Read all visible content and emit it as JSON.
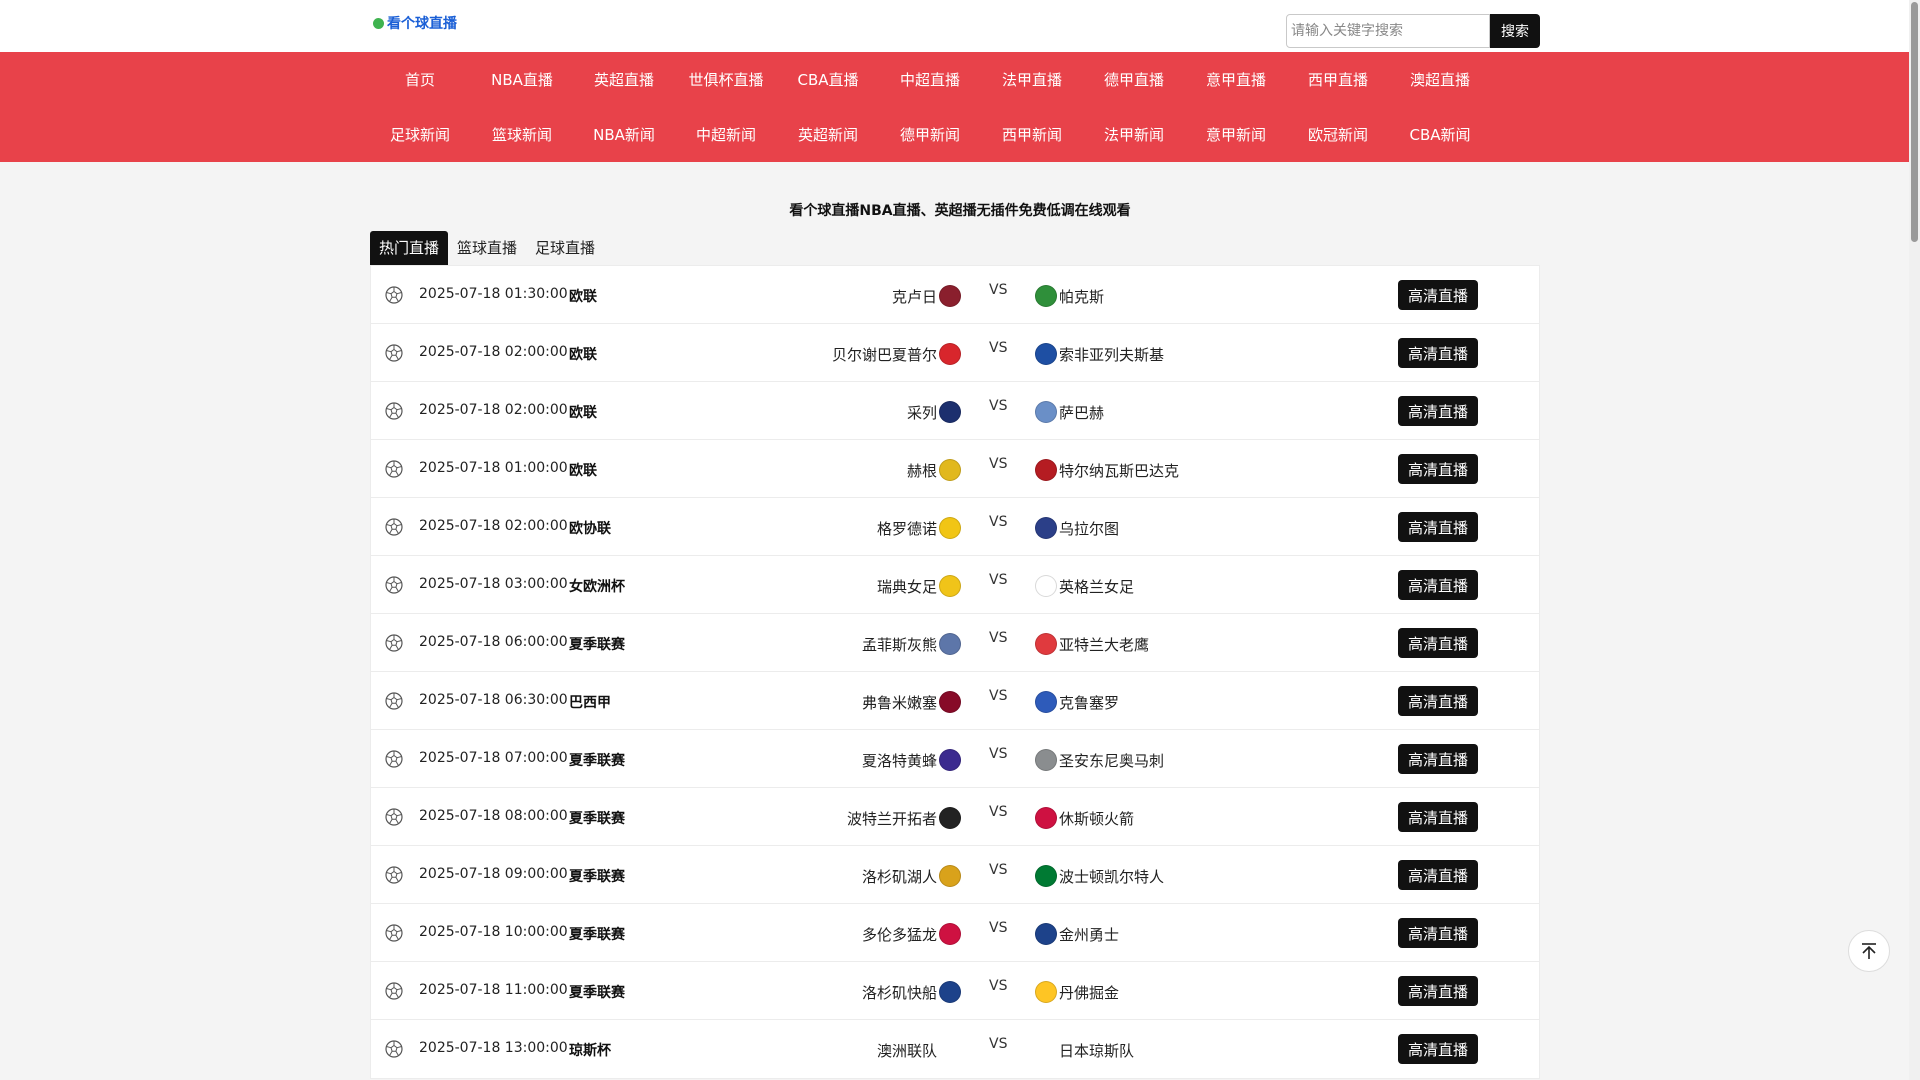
{
  "header": {
    "logo_text": "看个球直播",
    "search_placeholder": "请输入关键字搜索",
    "search_button": "搜索"
  },
  "nav": {
    "row1": [
      "首页",
      "NBA直播",
      "英超直播",
      "世俱杯直播",
      "CBA直播",
      "中超直播",
      "法甲直播",
      "德甲直播",
      "意甲直播",
      "西甲直播",
      "澳超直播"
    ],
    "row2": [
      "足球新闻",
      "篮球新闻",
      "NBA新闻",
      "中超新闻",
      "英超新闻",
      "德甲新闻",
      "西甲新闻",
      "法甲新闻",
      "意甲新闻",
      "欧冠新闻",
      "CBA新闻"
    ]
  },
  "headline": "看个球直播NBA直播、英超播无插件免费低调在线观看",
  "tabs": [
    "热门直播",
    "篮球直播",
    "足球直播"
  ],
  "vs_label": "VS",
  "live_label": "高清直播",
  "colors": {
    "nav_bg": "#e8424a",
    "button_bg": "#111111"
  },
  "matches": [
    {
      "time": "2025-07-18 01:30:00",
      "league": "欧联",
      "home": "克卢日",
      "away": "帕克斯",
      "home_color": "#8a1f2d",
      "away_color": "#2f8f3a"
    },
    {
      "time": "2025-07-18 02:00:00",
      "league": "欧联",
      "home": "贝尔谢巴夏普尔",
      "away": "索非亚列夫斯基",
      "home_color": "#d8262c",
      "away_color": "#1e4fa3"
    },
    {
      "time": "2025-07-18 02:00:00",
      "league": "欧联",
      "home": "采列",
      "away": "萨巴赫",
      "home_color": "#1c2f6e",
      "away_color": "#6a8fc7"
    },
    {
      "time": "2025-07-18 01:00:00",
      "league": "欧联",
      "home": "赫根",
      "away": "特尔纳瓦斯巴达克",
      "home_color": "#e1b81d",
      "away_color": "#b51c22"
    },
    {
      "time": "2025-07-18 02:00:00",
      "league": "欧协联",
      "home": "格罗德诺",
      "away": "乌拉尔图",
      "home_color": "#f1c515",
      "away_color": "#2b3f88"
    },
    {
      "time": "2025-07-18 03:00:00",
      "league": "女欧洲杯",
      "home": "瑞典女足",
      "away": "英格兰女足",
      "home_color": "#f0c419",
      "away_color": "#ffffff"
    },
    {
      "time": "2025-07-18 06:00:00",
      "league": "夏季联赛",
      "home": "孟菲斯灰熊",
      "away": "亚特兰大老鹰",
      "home_color": "#5d76a9",
      "away_color": "#e03a3e"
    },
    {
      "time": "2025-07-18 06:30:00",
      "league": "巴西甲",
      "home": "弗鲁米嫩塞",
      "away": "克鲁塞罗",
      "home_color": "#870a28",
      "away_color": "#2e5bba"
    },
    {
      "time": "2025-07-18 07:00:00",
      "league": "夏季联赛",
      "home": "夏洛特黄蜂",
      "away": "圣安东尼奥马刺",
      "home_color": "#3b2a8f",
      "away_color": "#8a8d8f"
    },
    {
      "time": "2025-07-18 08:00:00",
      "league": "夏季联赛",
      "home": "波特兰开拓者",
      "away": "休斯顿火箭",
      "home_color": "#222222",
      "away_color": "#ce1141"
    },
    {
      "time": "2025-07-18 09:00:00",
      "league": "夏季联赛",
      "home": "洛杉矶湖人",
      "away": "波士顿凯尔特人",
      "home_color": "#d9a21b",
      "away_color": "#007a33"
    },
    {
      "time": "2025-07-18 10:00:00",
      "league": "夏季联赛",
      "home": "多伦多猛龙",
      "away": "金州勇士",
      "home_color": "#ce1141",
      "away_color": "#1d428a"
    },
    {
      "time": "2025-07-18 11:00:00",
      "league": "夏季联赛",
      "home": "洛杉矶快船",
      "away": "丹佛掘金",
      "home_color": "#1d428a",
      "away_color": "#fec524"
    },
    {
      "time": "2025-07-18 13:00:00",
      "league": "琼斯杯",
      "home": "澳洲联队",
      "away": "日本琼斯队",
      "home_color": "",
      "away_color": ""
    }
  ]
}
